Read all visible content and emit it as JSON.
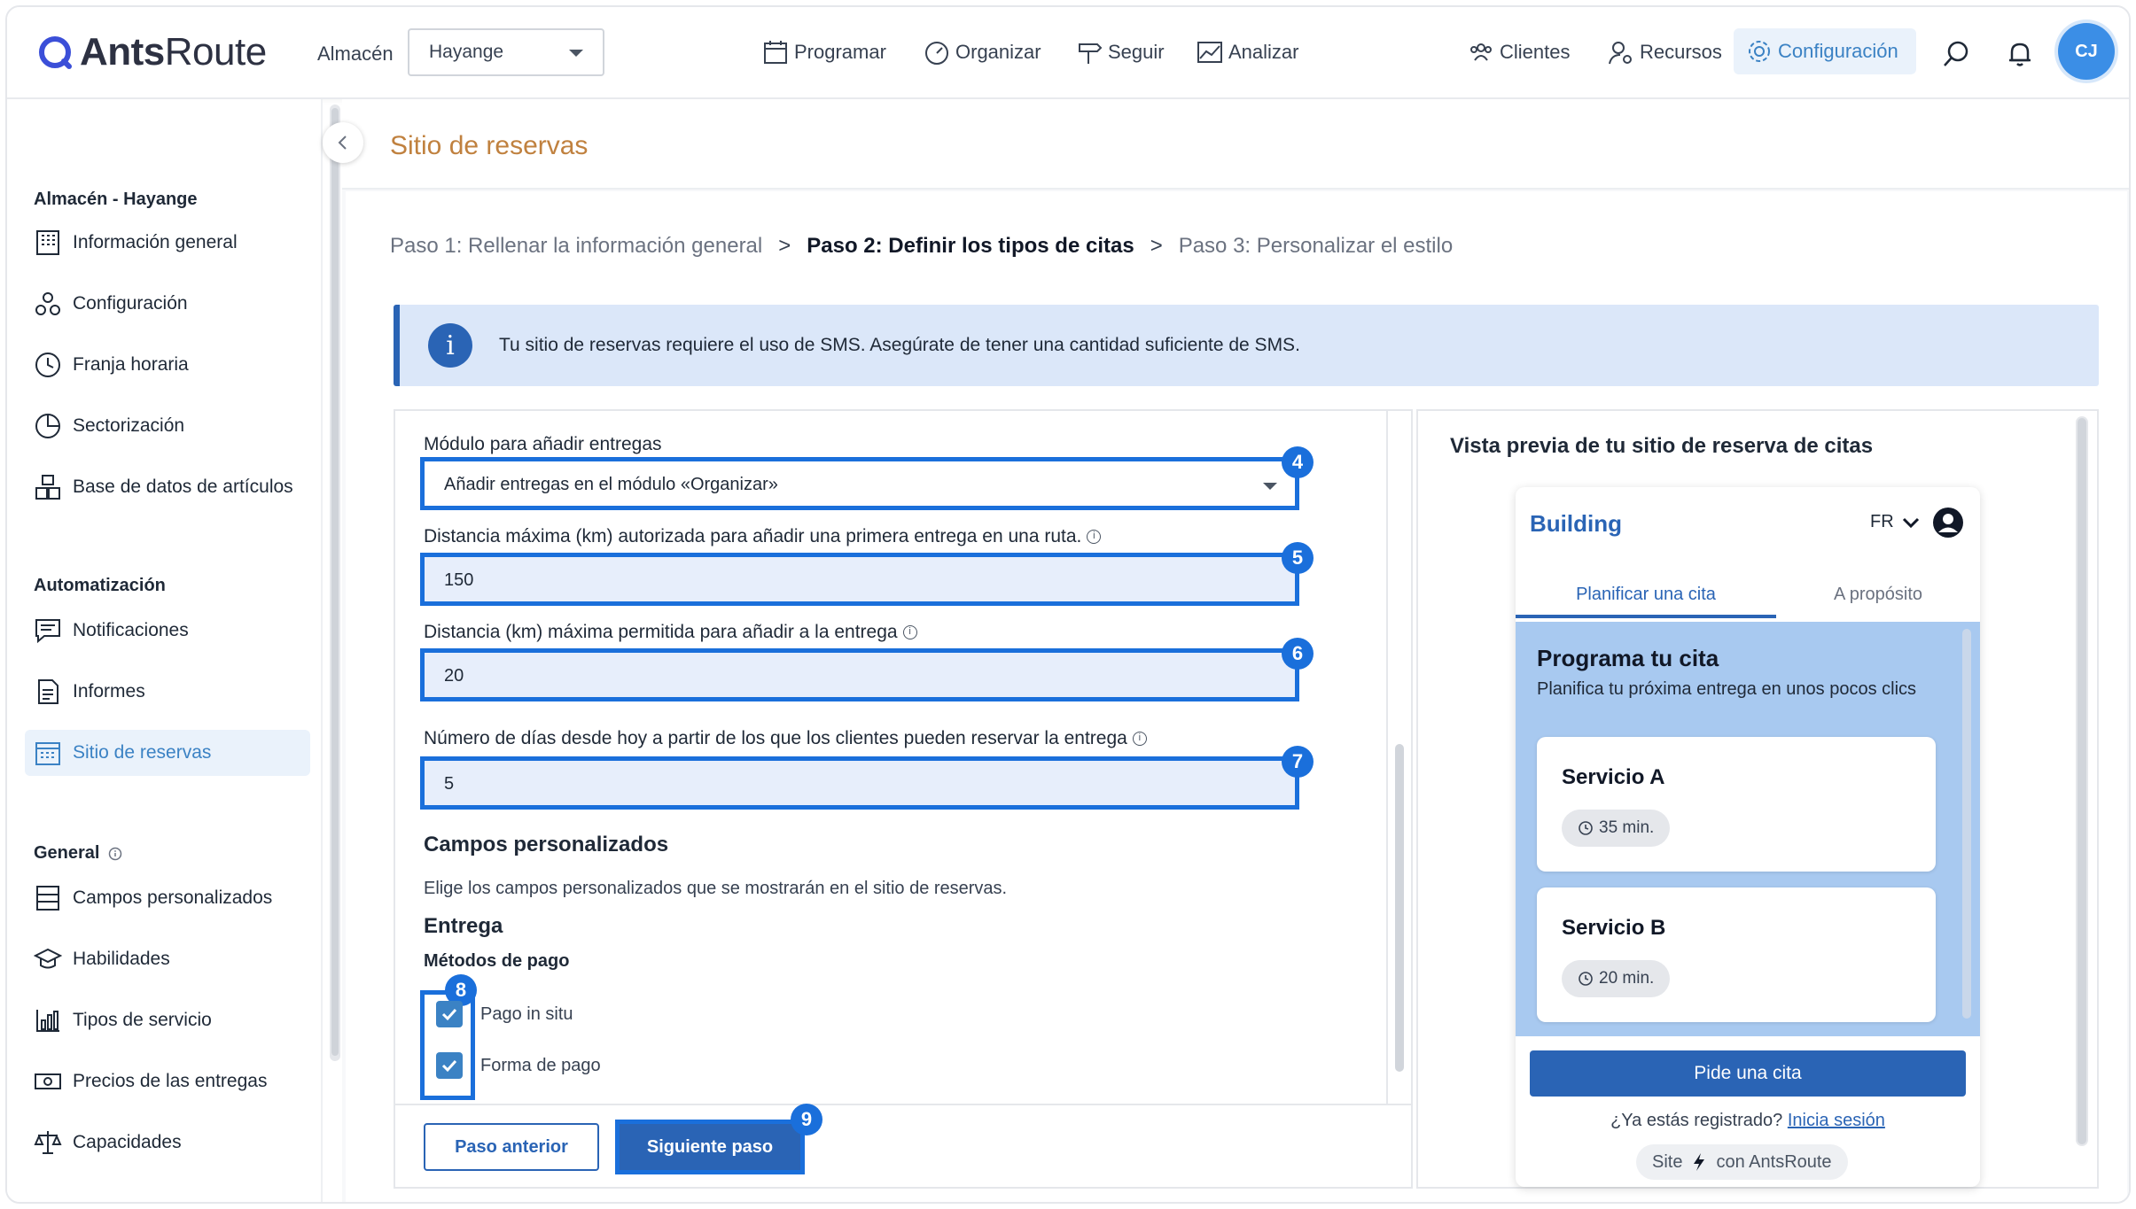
{
  "app": {
    "logo_bold": "Ants",
    "logo_light": "Route",
    "warehouse_label": "Almacén",
    "warehouse_value": "Hayange",
    "user_initials": "CJ"
  },
  "nav": {
    "programar": "Programar",
    "organizar": "Organizar",
    "seguir": "Seguir",
    "analizar": "Analizar",
    "clientes": "Clientes",
    "recursos": "Recursos",
    "configuracion": "Configuración"
  },
  "sidebar": {
    "section1": "Almacén - Hayange",
    "section1_items": [
      "Información general",
      "Configuración",
      "Franja horaria",
      "Sectorización",
      "Base de datos de artículos"
    ],
    "section2": "Automatización",
    "section2_items": [
      "Notificaciones",
      "Informes",
      "Sitio de reservas"
    ],
    "section3": "General",
    "section3_items": [
      "Campos personalizados",
      "Habilidades",
      "Tipos de servicio",
      "Precios de las entregas",
      "Capacidades"
    ]
  },
  "page": {
    "title": "Sitio de reservas",
    "step1": "Paso 1: Rellenar la información general",
    "step2": "Paso 2: Definir los tipos de citas",
    "step3": "Paso 3: Personalizar el estilo",
    "step_sep": ">",
    "info": "Tu sitio de reservas requiere el uso de SMS. Asegúrate de tener una cantidad suficiente de SMS."
  },
  "form": {
    "module_label": "Módulo para añadir entregas",
    "module_value": "Añadir entregas en el módulo «Organizar»",
    "max_first_label": "Distancia máxima (km) autorizada para añadir una primera entrega en una ruta.",
    "max_first_value": "150",
    "max_dist_label": "Distancia (km) máxima permitida para añadir a la entrega",
    "max_dist_value": "20",
    "days_label": "Número de días desde hoy a partir de los que los clientes pueden reservar la entrega",
    "days_value": "5",
    "custom_title": "Campos personalizados",
    "custom_desc": "Elige los campos personalizados que se mostrarán en el sitio de reservas.",
    "delivery_title": "Entrega",
    "payment_title": "Métodos de pago",
    "payment_options": [
      "Pago in situ",
      "Forma de pago"
    ],
    "prev_button": "Paso anterior",
    "next_button": "Siguiente paso",
    "badges": [
      "4",
      "5",
      "6",
      "7",
      "8",
      "9"
    ]
  },
  "preview": {
    "title": "Vista previa de tu sitio de reserva de citas",
    "brand": "Building",
    "lang": "FR",
    "tab_plan": "Planificar una cita",
    "tab_about": "A propósito",
    "heading": "Programa tu cita",
    "subheading": "Planifica tu próxima entrega en unos pocos clics",
    "services": [
      {
        "name": "Servicio A",
        "duration": "35 min."
      },
      {
        "name": "Servicio B",
        "duration": "20 min."
      }
    ],
    "cta": "Pide una cita",
    "login_q": "¿Ya estás registrado?",
    "login_link": "Inicia sesión",
    "footer_site": "Site",
    "footer_with": "con AntsRoute"
  },
  "colors": {
    "accent": "#2a64b5",
    "highlight": "#1a6fdb",
    "title_orange": "#c0813f",
    "preview_bg": "#a8c9f0"
  }
}
